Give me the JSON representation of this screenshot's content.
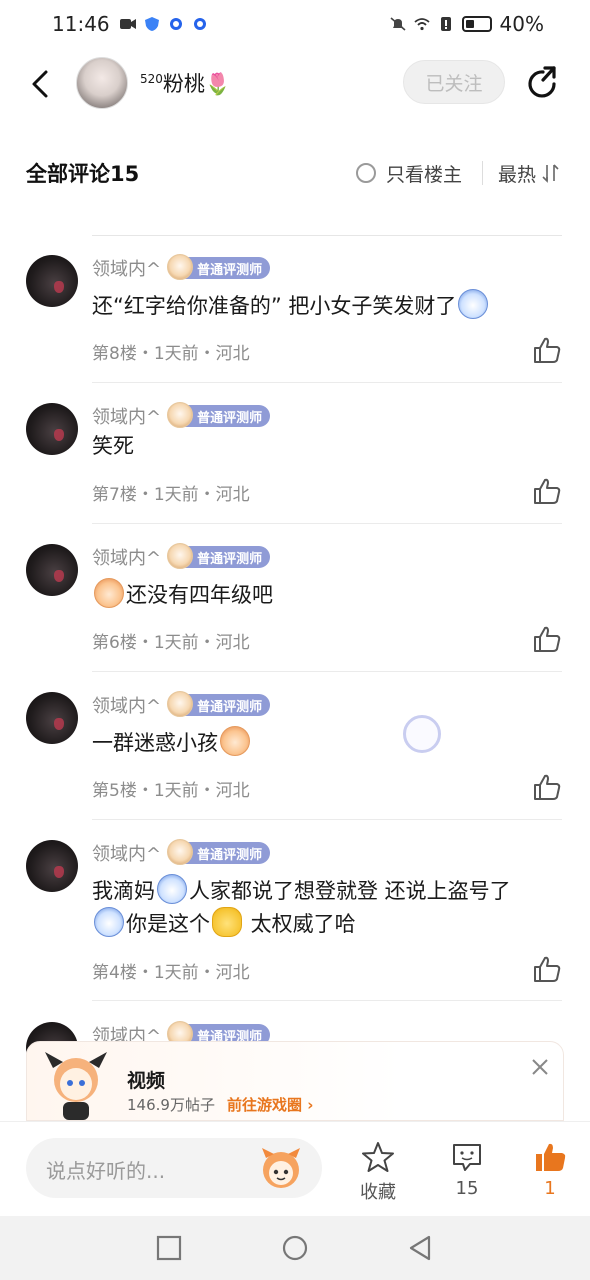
{
  "status_bar": {
    "time": "11:46",
    "battery": "40%"
  },
  "header": {
    "author_sup": "520",
    "author_name": "粉桃🌷",
    "follow_label": "已关注"
  },
  "comments_header": {
    "title": "全部评论15",
    "only_owner_label": "只看楼主",
    "sort_label": "最热"
  },
  "comments": [
    {
      "user": "领域内^",
      "badge": "普通评测师",
      "text": "还“红字给你准备的” 把小女子笑发财了",
      "meta": "第8楼・1天前・河北"
    },
    {
      "user": "领域内^",
      "badge": "普通评测师",
      "text": "笑死",
      "meta": "第7楼・1天前・河北"
    },
    {
      "user": "领域内^",
      "badge": "普通评测师",
      "text": "还没有四年级吧",
      "meta": "第6楼・1天前・河北"
    },
    {
      "user": "领域内^",
      "badge": "普通评测师",
      "text": "一群迷惑小孩",
      "meta": "第5楼・1天前・河北"
    },
    {
      "user": "领域内^",
      "badge": "普通评测师",
      "text_line1": "我滴妈",
      "text_line1b": "人家都说了想登就登 还说上盗号了",
      "text_line2a": "你是这个",
      "text_line2b": " 太权威了哈",
      "meta": "第4楼・1天前・河北"
    },
    {
      "user": "领域内^",
      "badge": "普通评测师"
    }
  ],
  "promo": {
    "title": "视频",
    "posts": "146.9万帖子",
    "link": "前往游戏圈"
  },
  "bottom_bar": {
    "input_placeholder": "说点好听的...",
    "favorite_label": "收藏",
    "comment_count": "15",
    "like_count": "1"
  },
  "colors": {
    "accent": "#e8761e",
    "badge": "#8f9bd6"
  }
}
